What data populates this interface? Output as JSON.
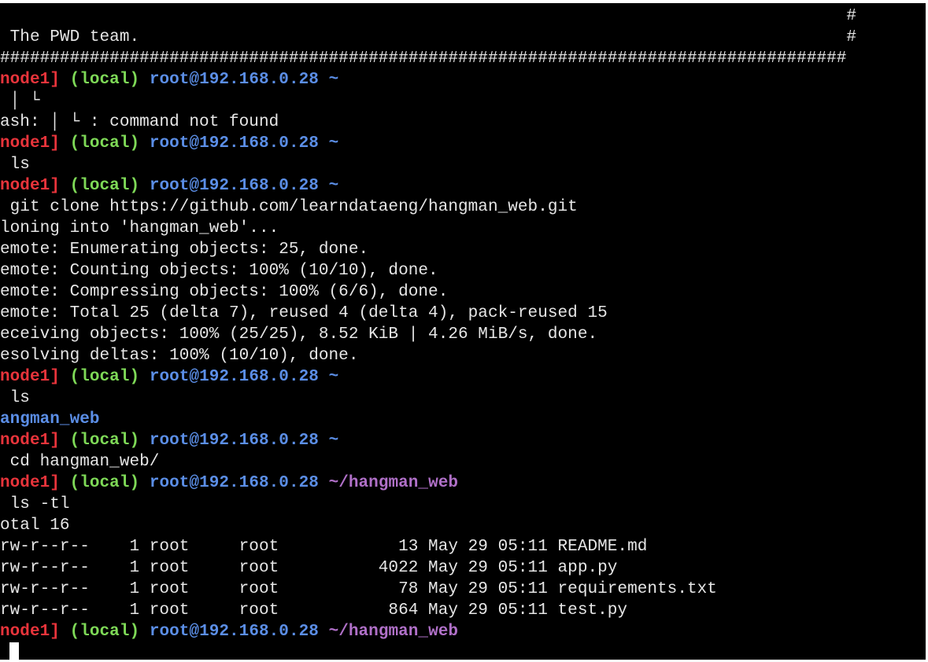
{
  "colors": {
    "background": "#000000",
    "text": "#e6e6e6",
    "prompt_node": "#e8343b",
    "prompt_local": "#7ed957",
    "prompt_user": "#5b8ee6",
    "prompt_dir": "#b070c8"
  },
  "terminal": {
    "banner": {
      "line1": "                                                                                     #",
      "line2": " The PWD team.                                                                       #",
      "line3": "#####################################################################################"
    },
    "prompt": {
      "node": "node1]",
      "local": "(local)",
      "user": "root@192.168.0.28",
      "home": "~",
      "hangman_dir": "~/hangman_web"
    },
    "commands": {
      "c1": " │ └",
      "c2": " ls",
      "c3": " git clone https://github.com/learndataeng/hangman_web.git",
      "c4": " ls",
      "c5": " cd hangman_web/",
      "c6": " ls -tl"
    },
    "output": {
      "not_found": "ash: │ └ : command not found",
      "cloning": "loning into 'hangman_web'...",
      "enumerating": "emote: Enumerating objects: 25, done.",
      "counting": "emote: Counting objects: 100% (10/10), done.",
      "compressing": "emote: Compressing objects: 100% (6/6), done.",
      "total": "emote: Total 25 (delta 7), reused 4 (delta 4), pack-reused 15",
      "receiving": "eceiving objects: 100% (25/25), 8.52 KiB | 4.26 MiB/s, done.",
      "resolving": "esolving deltas: 100% (10/10), done.",
      "dir_listing": "angman_web",
      "total16": "otal 16",
      "files": [
        "rw-r--r--    1 root     root            13 May 29 05:11 README.md",
        "rw-r--r--    1 root     root          4022 May 29 05:11 app.py",
        "rw-r--r--    1 root     root            78 May 29 05:11 requirements.txt",
        "rw-r--r--    1 root     root           864 May 29 05:11 test.py"
      ]
    }
  }
}
